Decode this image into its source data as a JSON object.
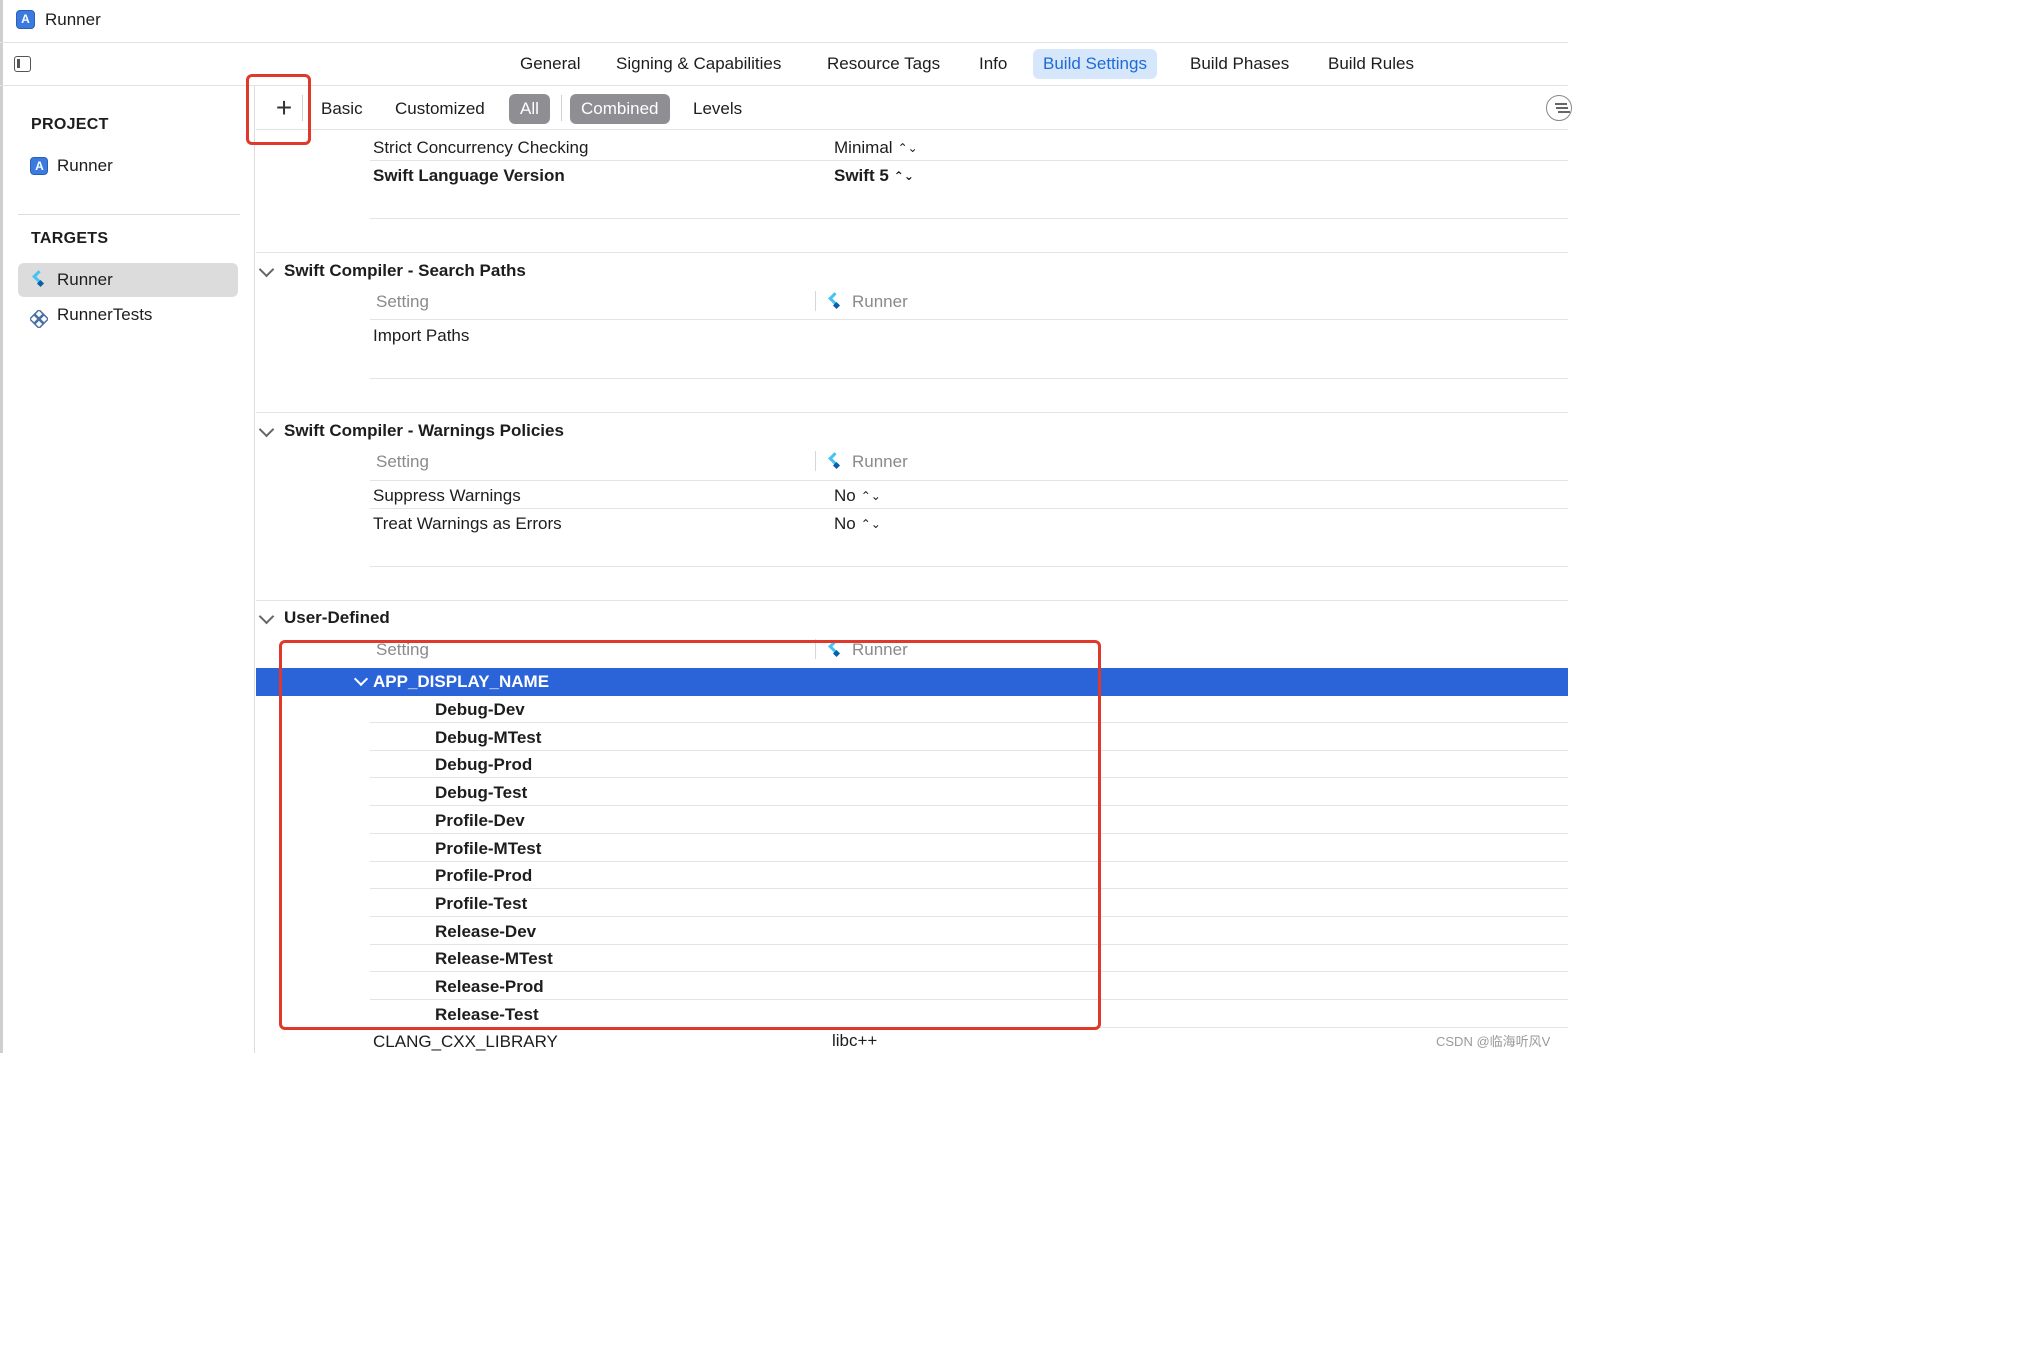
{
  "window": {
    "title": "Runner"
  },
  "tabs": [
    "General",
    "Signing & Capabilities",
    "Resource Tags",
    "Info",
    "Build Settings",
    "Build Phases",
    "Build Rules"
  ],
  "active_tab": "Build Settings",
  "sidebar": {
    "project_header": "PROJECT",
    "project_items": [
      {
        "label": "Runner",
        "icon": "xcode-project-icon"
      }
    ],
    "targets_header": "TARGETS",
    "target_items": [
      {
        "label": "Runner",
        "icon": "flutter-icon",
        "selected": true
      },
      {
        "label": "RunnerTests",
        "icon": "test-bundle-icon",
        "selected": false
      }
    ]
  },
  "filterbar": {
    "add_label": "+",
    "filters": [
      "Basic",
      "Customized",
      "All",
      "Combined",
      "Levels"
    ],
    "selected_filters": [
      "All",
      "Combined"
    ]
  },
  "top_rows": [
    {
      "name": "Strict Concurrency Checking",
      "value": "Minimal",
      "bold": false
    },
    {
      "name": "Swift Language Version",
      "value": "Swift 5",
      "bold": true
    }
  ],
  "groups": {
    "search_paths": {
      "title": "Swift Compiler - Search Paths",
      "col_setting": "Setting",
      "col_target": "Runner",
      "rows": [
        {
          "name": "Import Paths",
          "value": ""
        }
      ]
    },
    "warnings": {
      "title": "Swift Compiler - Warnings Policies",
      "col_setting": "Setting",
      "col_target": "Runner",
      "rows": [
        {
          "name": "Suppress Warnings",
          "value": "No"
        },
        {
          "name": "Treat Warnings as Errors",
          "value": "No"
        }
      ]
    },
    "user_defined": {
      "title": "User-Defined",
      "col_setting": "Setting",
      "col_target": "Runner",
      "expanded_setting": "APP_DISPLAY_NAME",
      "configurations": [
        "Debug-Dev",
        "Debug-MTest",
        "Debug-Prod",
        "Debug-Test",
        "Profile-Dev",
        "Profile-MTest",
        "Profile-Prod",
        "Profile-Test",
        "Release-Dev",
        "Release-MTest",
        "Release-Prod",
        "Release-Test"
      ],
      "next_setting": {
        "name": "CLANG_CXX_LIBRARY",
        "value": "libc++"
      }
    }
  },
  "watermark": "CSDN @临海听风V",
  "colors": {
    "accent": "#2a64d8",
    "highlight": "#e0392b",
    "tab_active_bg": "#d7e7fb"
  }
}
